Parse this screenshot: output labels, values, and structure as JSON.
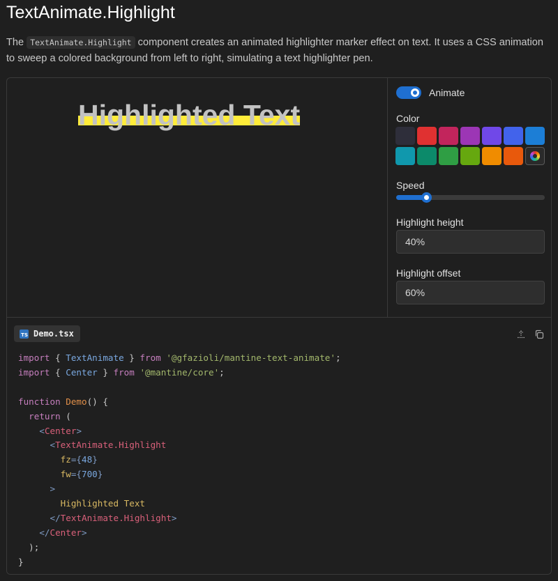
{
  "page": {
    "title": "TextAnimate.Highlight",
    "intro_before": "The ",
    "intro_code": "TextAnimate.Highlight",
    "intro_after": " component creates an animated highlighter marker effect on text. It uses a CSS animation to sweep a colored background from left to right, simulating a text highlighter pen."
  },
  "preview": {
    "text": "Highlighted Text",
    "highlight_color": "#ffec3a"
  },
  "controls": {
    "animate_label": "Animate",
    "animate_on": true,
    "color_label": "Color",
    "swatches": [
      "#2e2e3a",
      "#e03131",
      "#c2255c",
      "#9c36b5",
      "#7048e8",
      "#4263eb",
      "#1c7ed6",
      "#1098ad",
      "#0c8a6a",
      "#2f9e44",
      "#66a80f",
      "#f08c00",
      "#e8590c"
    ],
    "picker_icon": "color-wheel-icon",
    "speed_label": "Speed",
    "speed_value": 0.2,
    "highlight_height_label": "Highlight height",
    "highlight_height_value": "40%",
    "highlight_offset_label": "Highlight offset",
    "highlight_offset_value": "60%"
  },
  "code": {
    "file_name": "Demo.tsx",
    "file_icon": "TS",
    "share_icon": "share-icon",
    "copy_icon": "copy-icon",
    "lines": {
      "l1": {
        "kw": "import",
        "p1": " { ",
        "id": "TextAnimate",
        "p2": " } ",
        "from": "from",
        "sp": " ",
        "str": "'@gfazioli/mantine-text-animate'",
        "end": ";"
      },
      "l2": {
        "kw": "import",
        "p1": " { ",
        "id": "Center",
        "p2": " } ",
        "from": "from",
        "sp": " ",
        "str": "'@mantine/core'",
        "end": ";"
      },
      "l4": {
        "kw": "function",
        "sp": " ",
        "fn": "Demo",
        "rest": "() {"
      },
      "l5": {
        "indent": "  ",
        "kw": "return",
        "rest": " ("
      },
      "l6": {
        "indent": "    ",
        "open": "<",
        "tag": "Center",
        "close": ">"
      },
      "l7": {
        "indent": "      ",
        "open": "<",
        "tag": "TextAnimate.Highlight"
      },
      "l8": {
        "indent": "        ",
        "attr": "fz",
        "eq": "={",
        "num": "48",
        "end": "}"
      },
      "l9": {
        "indent": "        ",
        "attr": "fw",
        "eq": "={",
        "num": "700",
        "end": "}"
      },
      "l10": {
        "indent": "      ",
        "close": ">"
      },
      "l11": {
        "indent": "        ",
        "text": "Highlighted Text"
      },
      "l12": {
        "indent": "      ",
        "open": "</",
        "tag": "TextAnimate.Highlight",
        "close": ">"
      },
      "l13": {
        "indent": "    ",
        "open": "</",
        "tag": "Center",
        "close": ">"
      },
      "l14": {
        "text": "  );"
      },
      "l15": {
        "text": "}"
      }
    }
  }
}
